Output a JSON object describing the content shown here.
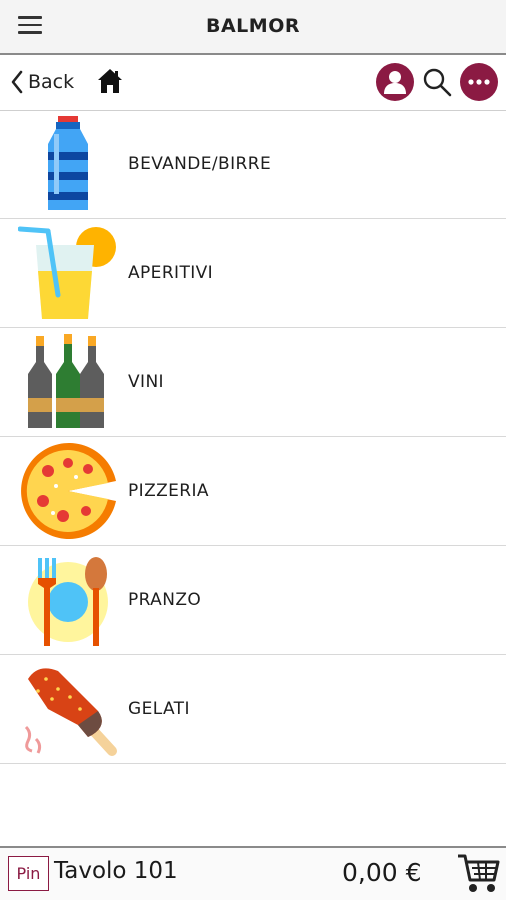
{
  "header": {
    "title": "BALMOR"
  },
  "nav": {
    "back_label": "Back",
    "icons": [
      "menu-icon",
      "chevron-left-icon",
      "home-icon",
      "user-icon",
      "search-icon",
      "more-icon"
    ]
  },
  "categories": [
    {
      "label": "BEVANDE/BIRRE",
      "icon": "water-bottle-icon"
    },
    {
      "label": "APERITIVI",
      "icon": "drink-glass-icon"
    },
    {
      "label": "VINI",
      "icon": "wine-bottles-icon"
    },
    {
      "label": "PIZZERIA",
      "icon": "pizza-icon"
    },
    {
      "label": "PRANZO",
      "icon": "plate-cutlery-icon"
    },
    {
      "label": "GELATI",
      "icon": "ice-cream-icon"
    }
  ],
  "footer": {
    "pin_label": "Pin",
    "table_label": "Tavolo 101",
    "total": "0,00 €",
    "cart_icon": "cart-icon"
  },
  "colors": {
    "accent": "#8b1a43",
    "topbar": "#f4f4f4"
  }
}
